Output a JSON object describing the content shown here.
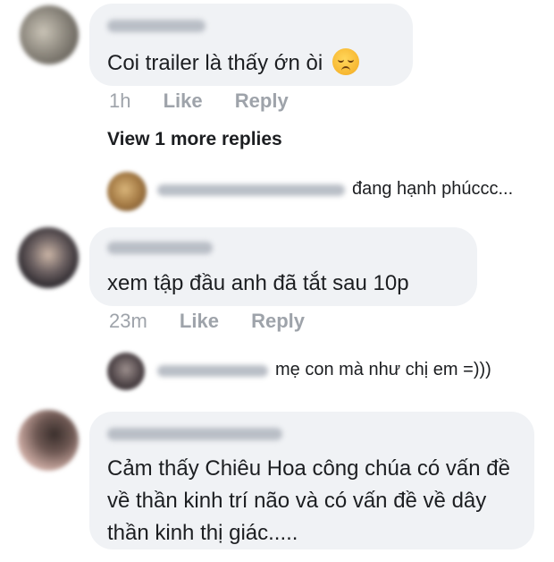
{
  "comments": [
    {
      "text": "Coi trailer là thấy ớn òi",
      "emoji": "disappointed-face-icon",
      "time": "1h",
      "like": "Like",
      "reply": "Reply"
    },
    {
      "text": "xem tập đầu anh đã tắt sau 10p",
      "time": "23m",
      "like": "Like",
      "reply": "Reply"
    },
    {
      "text": "Cảm thấy Chiêu Hoa công chúa có vấn đề về thần kinh trí não và có vấn đề về dây thần kinh thị giác.....",
      "time": "",
      "like": "",
      "reply": ""
    }
  ],
  "view_more": "View 1 more replies",
  "reply_previews": [
    {
      "snippet": "đang hạnh phúccc..."
    },
    {
      "snippet": "mẹ con mà như chị em =)))"
    }
  ]
}
